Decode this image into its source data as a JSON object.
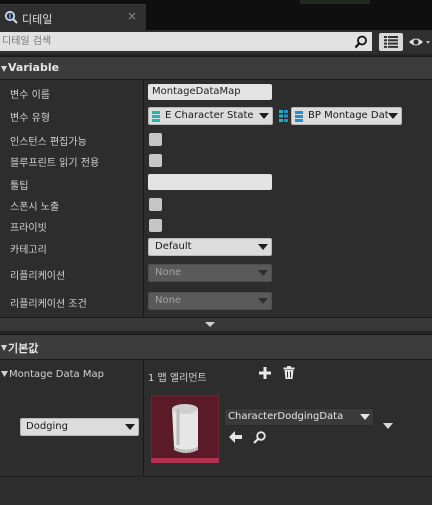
{
  "tab": {
    "title": "디테일",
    "close": "×"
  },
  "search": {
    "placeholder": "디테일 검색"
  },
  "variable_section": {
    "title": "Variable",
    "rows": [
      {
        "label": "변수 이름",
        "value": "MontageDataMap"
      },
      {
        "label": "변수 유형",
        "key_type": "E Character State",
        "value_type": "BP Montage Data A"
      },
      {
        "label": "인스턴스 편집가능",
        "checked": false
      },
      {
        "label": "블루프린트 읽기 전용",
        "checked": false
      },
      {
        "label": "툴팁",
        "value": ""
      },
      {
        "label": "스폰시 노출",
        "checked": false
      },
      {
        "label": "프라이빗",
        "checked": false
      },
      {
        "label": "카테고리",
        "value": "Default"
      },
      {
        "label": "리플리케이션",
        "value": "None"
      },
      {
        "label": "리플리케이션 조건",
        "value": "None"
      }
    ]
  },
  "defaults_section": {
    "title": "기본값",
    "map_label": "Montage Data Map",
    "element_count": "1 맵 엘리먼트",
    "entry_key": "Dodging",
    "entry_value": "CharacterDodgingData"
  },
  "colors": {
    "key_type_icon": "#1fb5b5",
    "value_type_icon": "#1e8fd6",
    "thumbnail_bg": "#5a1a28",
    "thumbnail_accent": "#b0304f"
  },
  "icons": {
    "tab": "details-icon",
    "search": "search-icon",
    "view": "grid-view-icon",
    "visibility": "eye-icon",
    "add": "plus-icon",
    "delete": "trash-icon",
    "use_selected": "arrow-left-icon",
    "browse": "magnifier-icon"
  }
}
